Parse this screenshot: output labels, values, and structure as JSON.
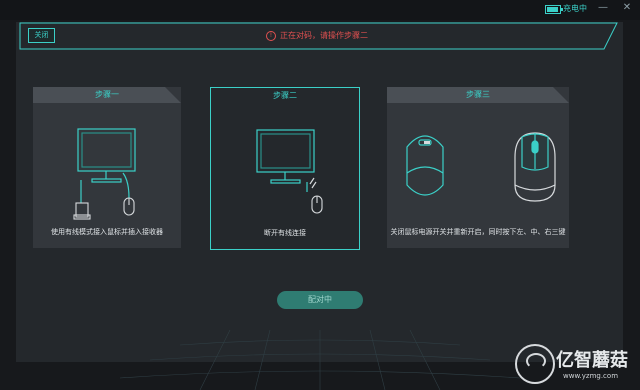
{
  "titlebar": {
    "charge_label": "充电中",
    "battery_level": 0.9,
    "minimize_glyph": "—",
    "close_glyph": "✕"
  },
  "header": {
    "close_label": "关闭",
    "status_text": "正在对码，请操作步骤二",
    "status_icon": "!"
  },
  "steps": [
    {
      "title": "步骤一",
      "description": "使用有线模式接入鼠标并插入接收器",
      "icon": "monitor-with-receiver-and-mouse"
    },
    {
      "title": "步骤二",
      "description": "断开有线连接",
      "icon": "monitor-with-disconnected-mouse"
    },
    {
      "title": "步骤三",
      "description": "关闭鼠标电源开关并重新开启，同时按下左、中、右三键",
      "icon": "mouse-bottom-and-top"
    }
  ],
  "pair_button": {
    "label": "配对中"
  },
  "watermark": {
    "text": "亿智蘑菇",
    "url": "www.yzmg.com"
  },
  "colors": {
    "accent": "#3bd0c8",
    "alert": "#e05050",
    "panel": "#24282c",
    "card": "#33373c"
  }
}
